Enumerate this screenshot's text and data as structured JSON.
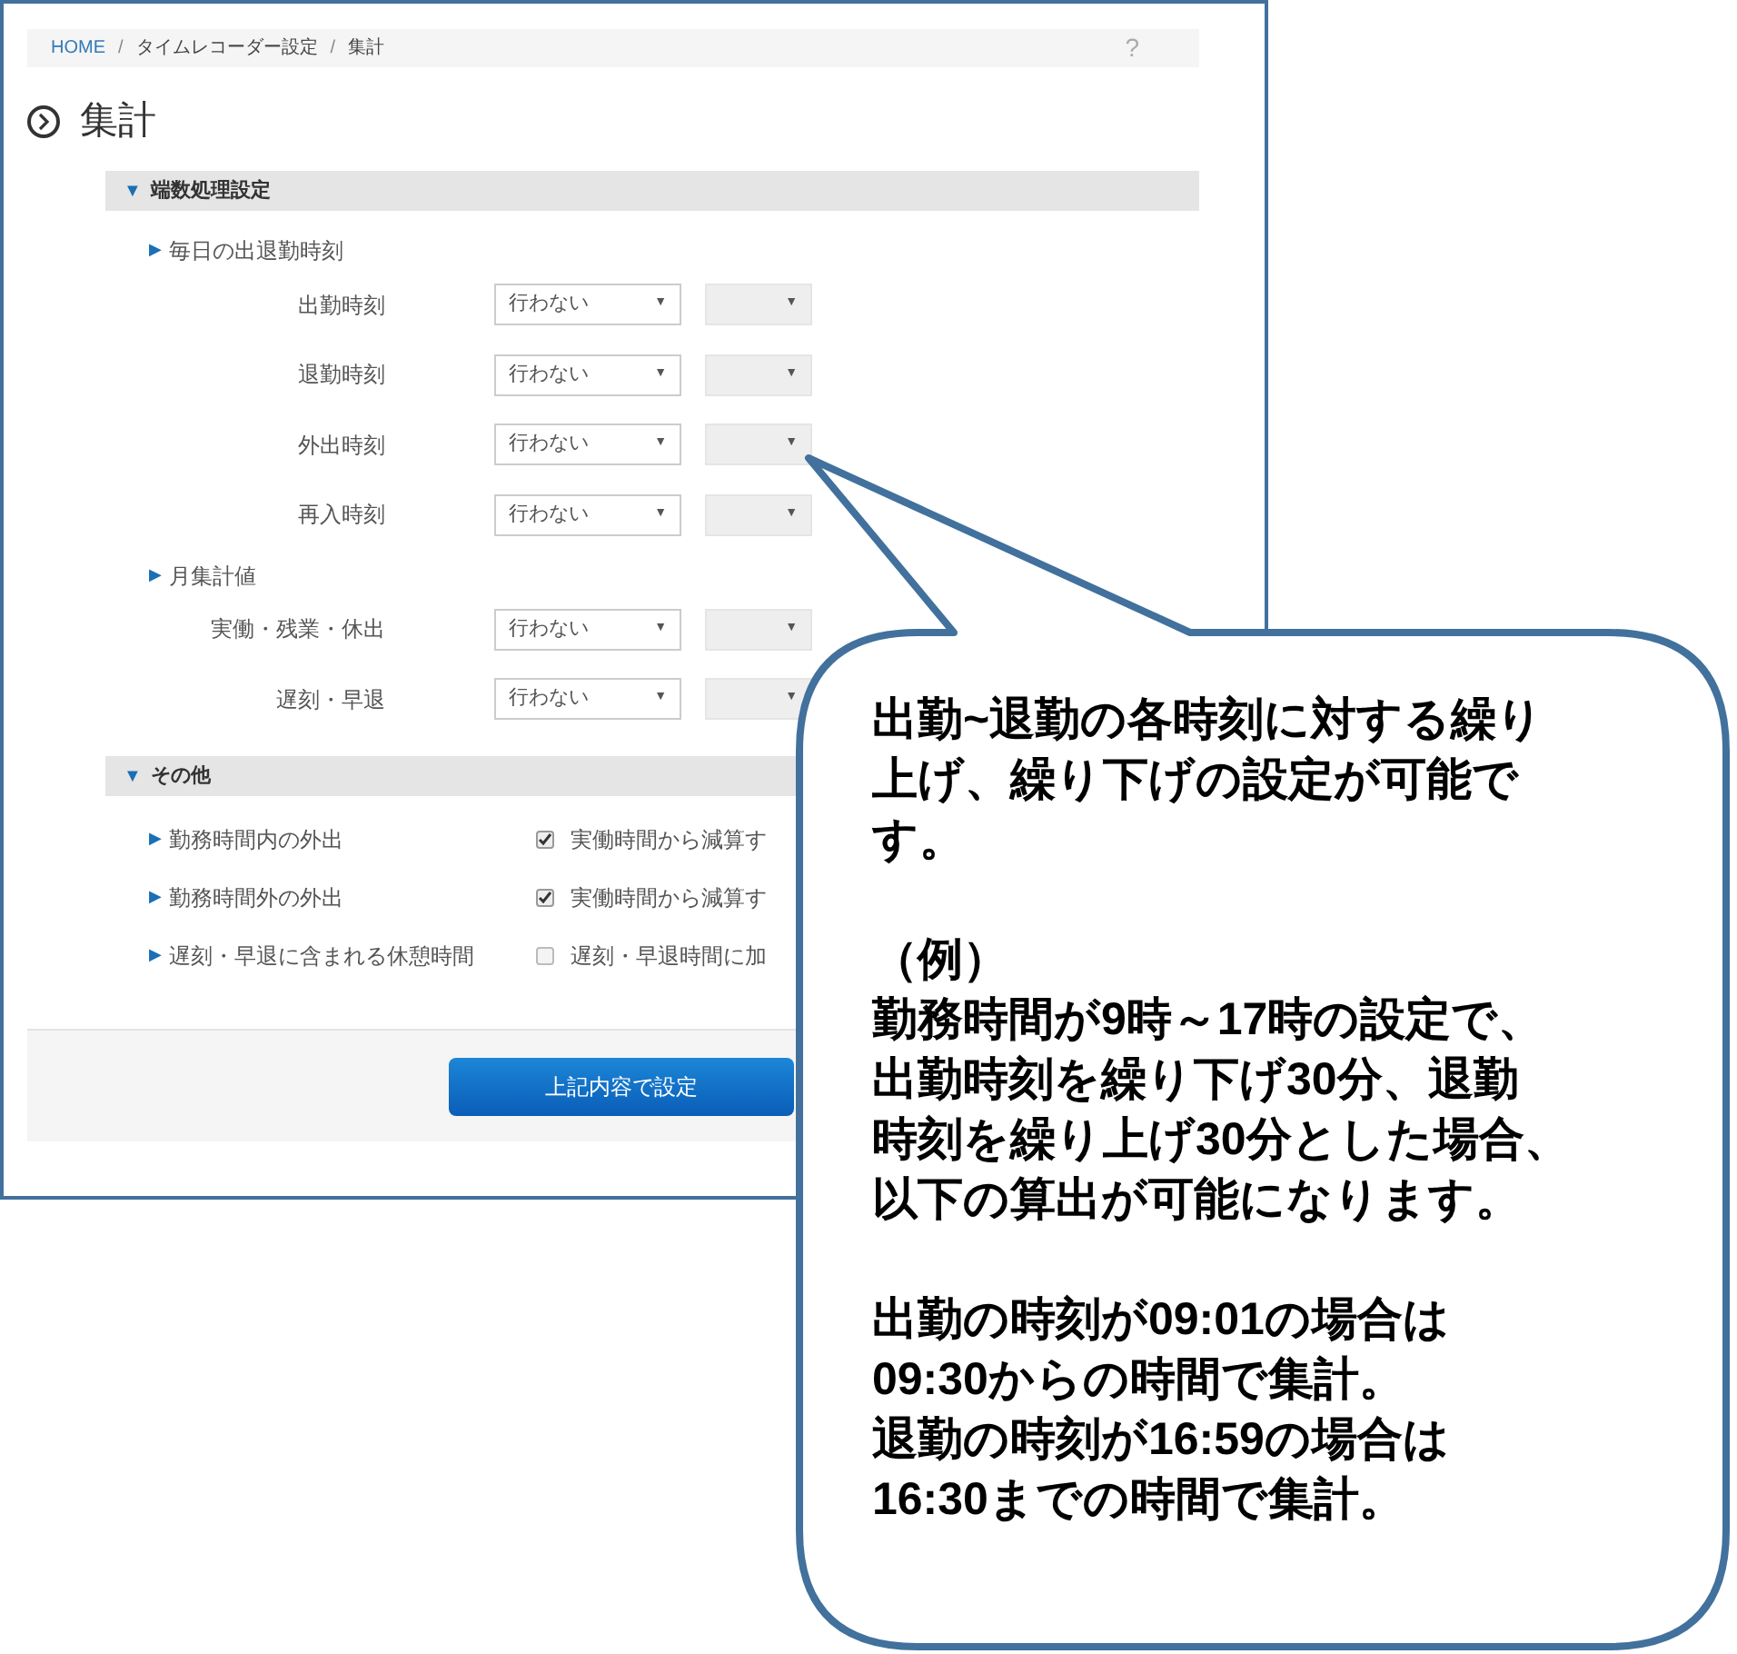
{
  "breadcrumb": [
    {
      "label": "HOME",
      "link": true
    },
    {
      "label": "タイムレコーダー設定",
      "link": false
    },
    {
      "label": "集計",
      "link": false
    }
  ],
  "breadcrumb_separator": "/",
  "help": "?",
  "page_title": "集計",
  "sections": [
    {
      "title": "端数処理設定",
      "marker": "▼",
      "groups": [
        {
          "title": "毎日の出退勤時刻",
          "marker": "▶",
          "rows": [
            {
              "label": "出勤時刻",
              "select": "行わない",
              "select2_disabled": true
            },
            {
              "label": "退勤時刻",
              "select": "行わない",
              "select2_disabled": true
            },
            {
              "label": "外出時刻",
              "select": "行わない",
              "select2_disabled": true
            },
            {
              "label": "再入時刻",
              "select": "行わない",
              "select2_disabled": true
            }
          ]
        },
        {
          "title": "月集計値",
          "marker": "▶",
          "rows": [
            {
              "label": "実働・残業・休出",
              "select": "行わない",
              "select2_disabled": true
            },
            {
              "label": "遅刻・早退",
              "select": "行わない",
              "select2_disabled": true
            }
          ]
        }
      ]
    },
    {
      "title": "その他",
      "marker": "▼",
      "options": [
        {
          "label": "勤務時間内の外出",
          "marker": "▶",
          "checked": true,
          "text": "実働時間から減算す"
        },
        {
          "label": "勤務時間外の外出",
          "marker": "▶",
          "checked": true,
          "text": "実働時間から減算す"
        },
        {
          "label": "遅刻・早退に含まれる休憩時間",
          "marker": "▶",
          "checked": false,
          "text": "遅刻・早退時間に加"
        }
      ]
    }
  ],
  "submit": "上記内容で設定",
  "callout": {
    "paragraphs": [
      [
        "出勤~退勤の各時刻に対する繰り",
        "上げ、繰り下げの設定が可能で",
        "す。"
      ],
      [
        "（例）",
        "勤務時間が9時～17時の設定で、",
        "出勤時刻を繰り下げ30分、退勤",
        "時刻を繰り上げ30分とした場合、",
        "以下の算出が可能になります。"
      ],
      [
        "出勤の時刻が09:01の場合は",
        "09:30からの時間で集計。",
        "退勤の時刻が16:59の場合は",
        "16:30までの時間で集計。"
      ]
    ]
  }
}
